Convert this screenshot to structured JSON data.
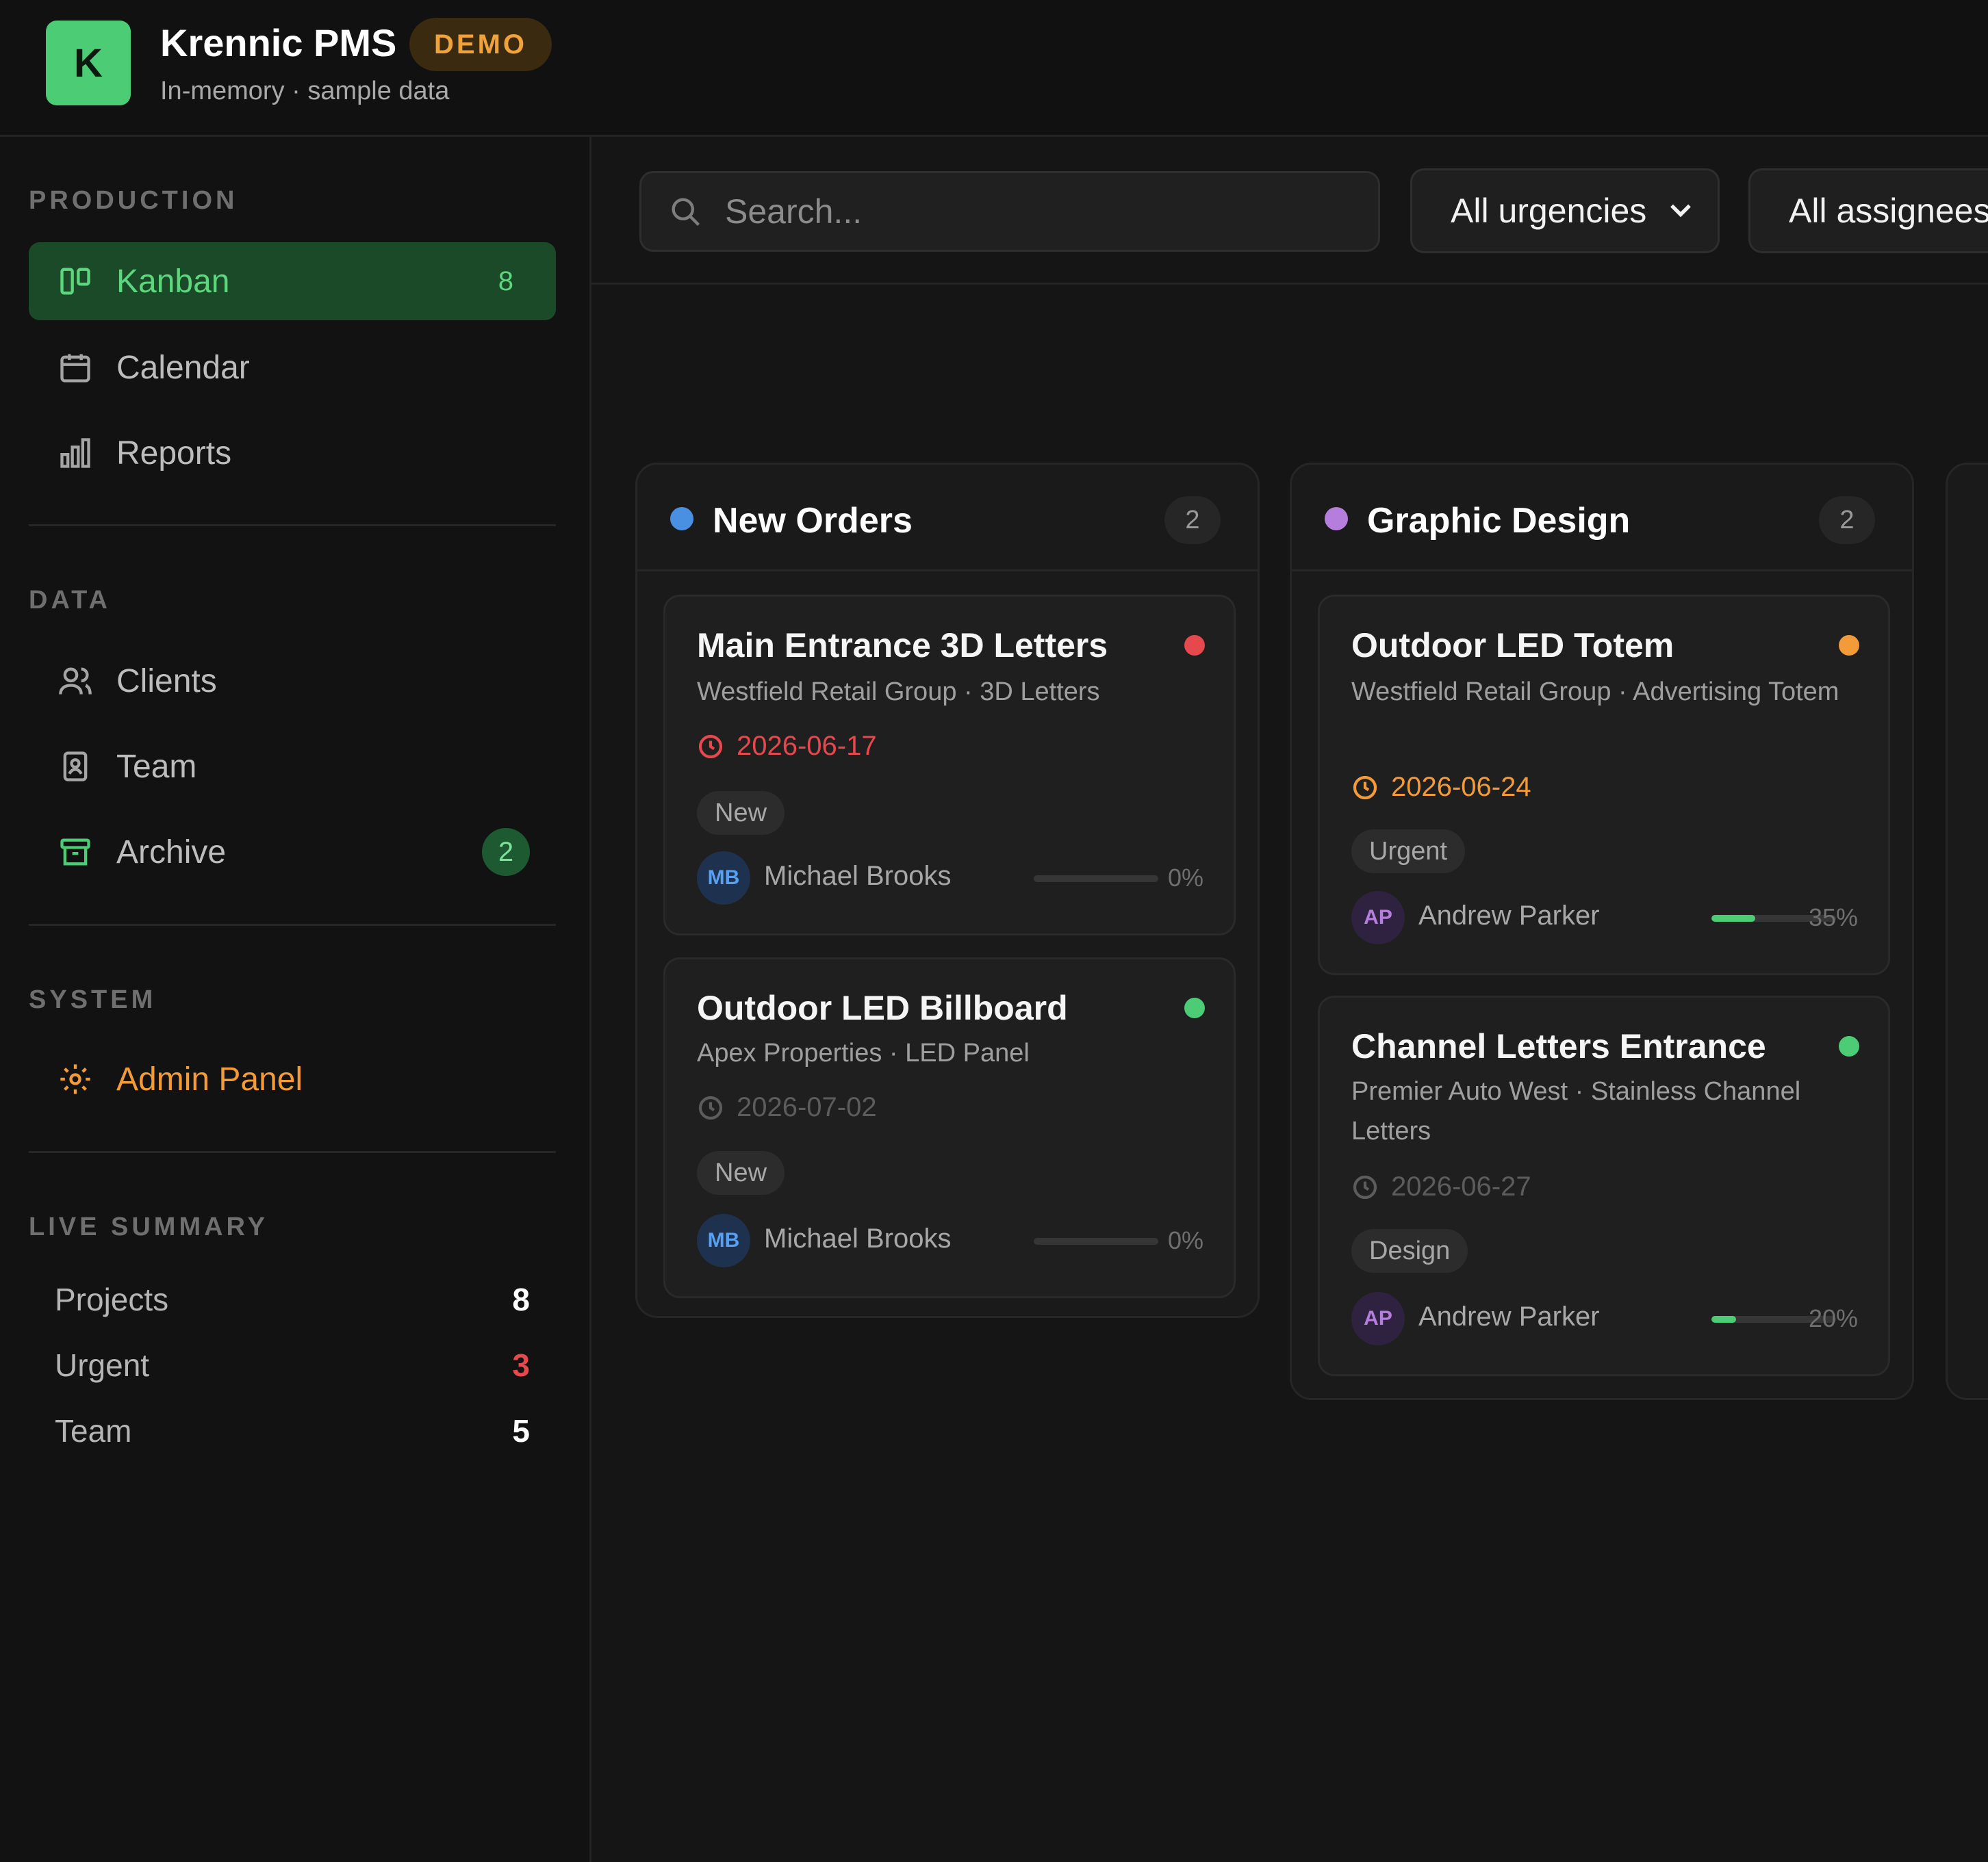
{
  "app": {
    "logo_letter": "K",
    "title": "Krennic PMS",
    "badge": "DEMO",
    "subtitle": "In-memory · sample data"
  },
  "sidebar": {
    "sections": {
      "production": "PRODUCTION",
      "data": "DATA",
      "system": "SYSTEM",
      "live_summary": "LIVE SUMMARY"
    },
    "production_items": [
      {
        "label": "Kanban",
        "icon": "kanban-icon",
        "count": "8",
        "active": true
      },
      {
        "label": "Calendar",
        "icon": "calendar-icon"
      },
      {
        "label": "Reports",
        "icon": "bar-chart-icon"
      }
    ],
    "data_items": [
      {
        "label": "Clients",
        "icon": "users-icon"
      },
      {
        "label": "Team",
        "icon": "id-badge-icon"
      },
      {
        "label": "Archive",
        "icon": "archive-icon",
        "count": "2"
      }
    ],
    "system_items": [
      {
        "label": "Admin Panel",
        "icon": "gear-icon"
      }
    ],
    "summary": [
      {
        "label": "Projects",
        "value": "8"
      },
      {
        "label": "Urgent",
        "value": "3"
      },
      {
        "label": "Team",
        "value": "5"
      }
    ]
  },
  "toolbar": {
    "search_placeholder": "Search...",
    "urgency_filter": "All urgencies",
    "assignee_filter": "All assignees"
  },
  "columns": [
    {
      "title": "New Orders",
      "count": "2",
      "dot_color": "#4a90e2",
      "cards": [
        {
          "title": "Main Entrance 3D Letters",
          "subtitle": "Westfield Retail Group · 3D Letters",
          "date": "2026-06-17",
          "date_color": "#e5484d",
          "tag": "New",
          "assignee_initials": "MB",
          "assignee": "Michael Brooks",
          "progress": 0,
          "progress_label": "0%",
          "status_color": "#e5484d"
        },
        {
          "title": "Outdoor LED Billboard",
          "subtitle": "Apex Properties · LED Panel",
          "date": "2026-07-02",
          "date_color": "#5c5c5c",
          "tag": "New",
          "assignee_initials": "MB",
          "assignee": "Michael Brooks",
          "progress": 0,
          "progress_label": "0%",
          "status_color": "#4ccc74"
        }
      ]
    },
    {
      "title": "Graphic Design",
      "count": "2",
      "dot_color": "#b57edc",
      "cards": [
        {
          "title": "Outdoor LED Totem",
          "subtitle": "Westfield Retail Group · Advertising Totem",
          "date": "2026-06-24",
          "date_color": "#f29b38",
          "tag": "Urgent",
          "assignee_initials": "AP",
          "assignee": "Andrew Parker",
          "progress": 35,
          "progress_label": "35%",
          "status_color": "#f29b38"
        },
        {
          "title": "Channel Letters Entrance",
          "subtitle": "Premier Auto West · Stainless Channel Letters",
          "date": "2026-06-27",
          "date_color": "#5c5c5c",
          "tag": "Design",
          "assignee_initials": "AP",
          "assignee": "Andrew Parker",
          "progress": 20,
          "progress_label": "20%",
          "status_color": "#4ccc74"
        }
      ]
    }
  ],
  "colors": {
    "accent_green": "#4ccc74",
    "urgent_red": "#e5484d",
    "warning_orange": "#f29b38",
    "avatar_mb_bg": "#1e3250",
    "avatar_mb_fg": "#5aa0f0",
    "avatar_ap_bg": "#2e2240",
    "avatar_ap_fg": "#b57edc"
  }
}
